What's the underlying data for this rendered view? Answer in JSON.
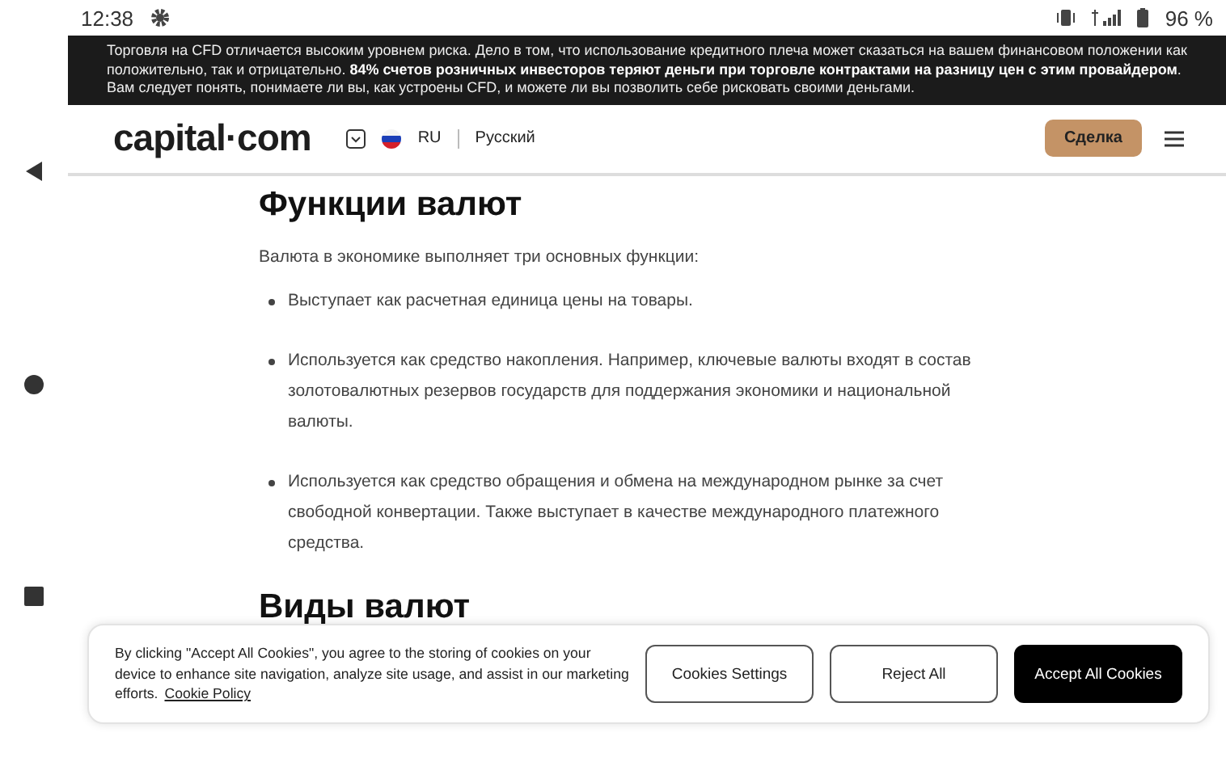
{
  "status_bar": {
    "time": "12:38",
    "battery": "96 %"
  },
  "risk_banner": {
    "text": "Торговля на CFD отличается высоким уровнем риска. Дело в том, что использование кредитного плеча может сказаться на вашем финансовом положении как положительно, так и отрицательно. **84% счетов розничных инвесторов теряют деньги при торговле контрактами на разницу цен с этим провайдером**. Вам следует понять, понимаете ли вы, как устроены CFD, и можете ли вы позволить себе рисковать своими деньгами."
  },
  "header": {
    "logo": "capital·com",
    "language_code": "RU",
    "language": "Русский",
    "trade_button": "Сделка"
  },
  "article": {
    "heading": "Функции валют",
    "intro": "Валюта в экономике выполняет три основных функции:",
    "bullets": [
      "Выступает как расчетная единица цены на товары.",
      "Используется как средство накопления. Например, ключевые валюты входят в состав золотовалютных резервов государств для поддержания экономики и национальной валюты.",
      "Используется как средство обращения и обмена на международном рынке за счет свободной конвертации. Также выступает в качестве международного платежного средства."
    ],
    "heading_2": "Виды валют"
  },
  "cookie_banner": {
    "text": "By clicking \"Accept All Cookies\", you agree to the storing of cookies on your device to enhance site navigation, analyze site usage, and assist in our marketing efforts.",
    "link": "Cookie Policy",
    "buttons": [
      {
        "label": "Cookies Settings",
        "kind": "outline"
      },
      {
        "label": "Reject All",
        "kind": "outline"
      },
      {
        "label": "Accept All Cookies",
        "kind": "primary"
      }
    ]
  }
}
